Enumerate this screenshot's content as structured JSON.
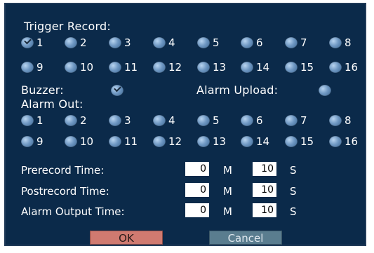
{
  "labels": {
    "trigger_record": "Trigger Record:",
    "buzzer": "Buzzer:",
    "alarm_upload": "Alarm Upload:",
    "alarm_out": "Alarm Out:",
    "prerecord_time": "Prerecord Time:",
    "postrecord_time": "Postrecord Time:",
    "alarm_output_time": "Alarm Output Time:"
  },
  "trigger_record": {
    "numbers": [
      "1",
      "2",
      "3",
      "4",
      "5",
      "6",
      "7",
      "8",
      "9",
      "10",
      "11",
      "12",
      "13",
      "14",
      "15",
      "16"
    ],
    "checked": [
      "1"
    ]
  },
  "alarm_out": {
    "numbers": [
      "1",
      "2",
      "3",
      "4",
      "5",
      "6",
      "7",
      "8",
      "9",
      "10",
      "11",
      "12",
      "13",
      "14",
      "15",
      "16"
    ],
    "checked": []
  },
  "buzzer_checked": true,
  "alarm_upload_checked": false,
  "prerecord": {
    "minutes": "0",
    "minute_unit": "M",
    "seconds": "10",
    "second_unit": "S"
  },
  "postrecord": {
    "minutes": "0",
    "minute_unit": "M",
    "seconds": "10",
    "second_unit": "S"
  },
  "alarm_output": {
    "minutes": "0",
    "minute_unit": "M",
    "seconds": "10",
    "second_unit": "S"
  },
  "buttons": {
    "ok": "OK",
    "cancel": "Cancel"
  },
  "colors": {
    "panel_bg": "#0b2a4a",
    "ok_bg": "#d07a70",
    "cancel_bg": "#5a7d8f",
    "checkbox": "#6e97c2"
  }
}
